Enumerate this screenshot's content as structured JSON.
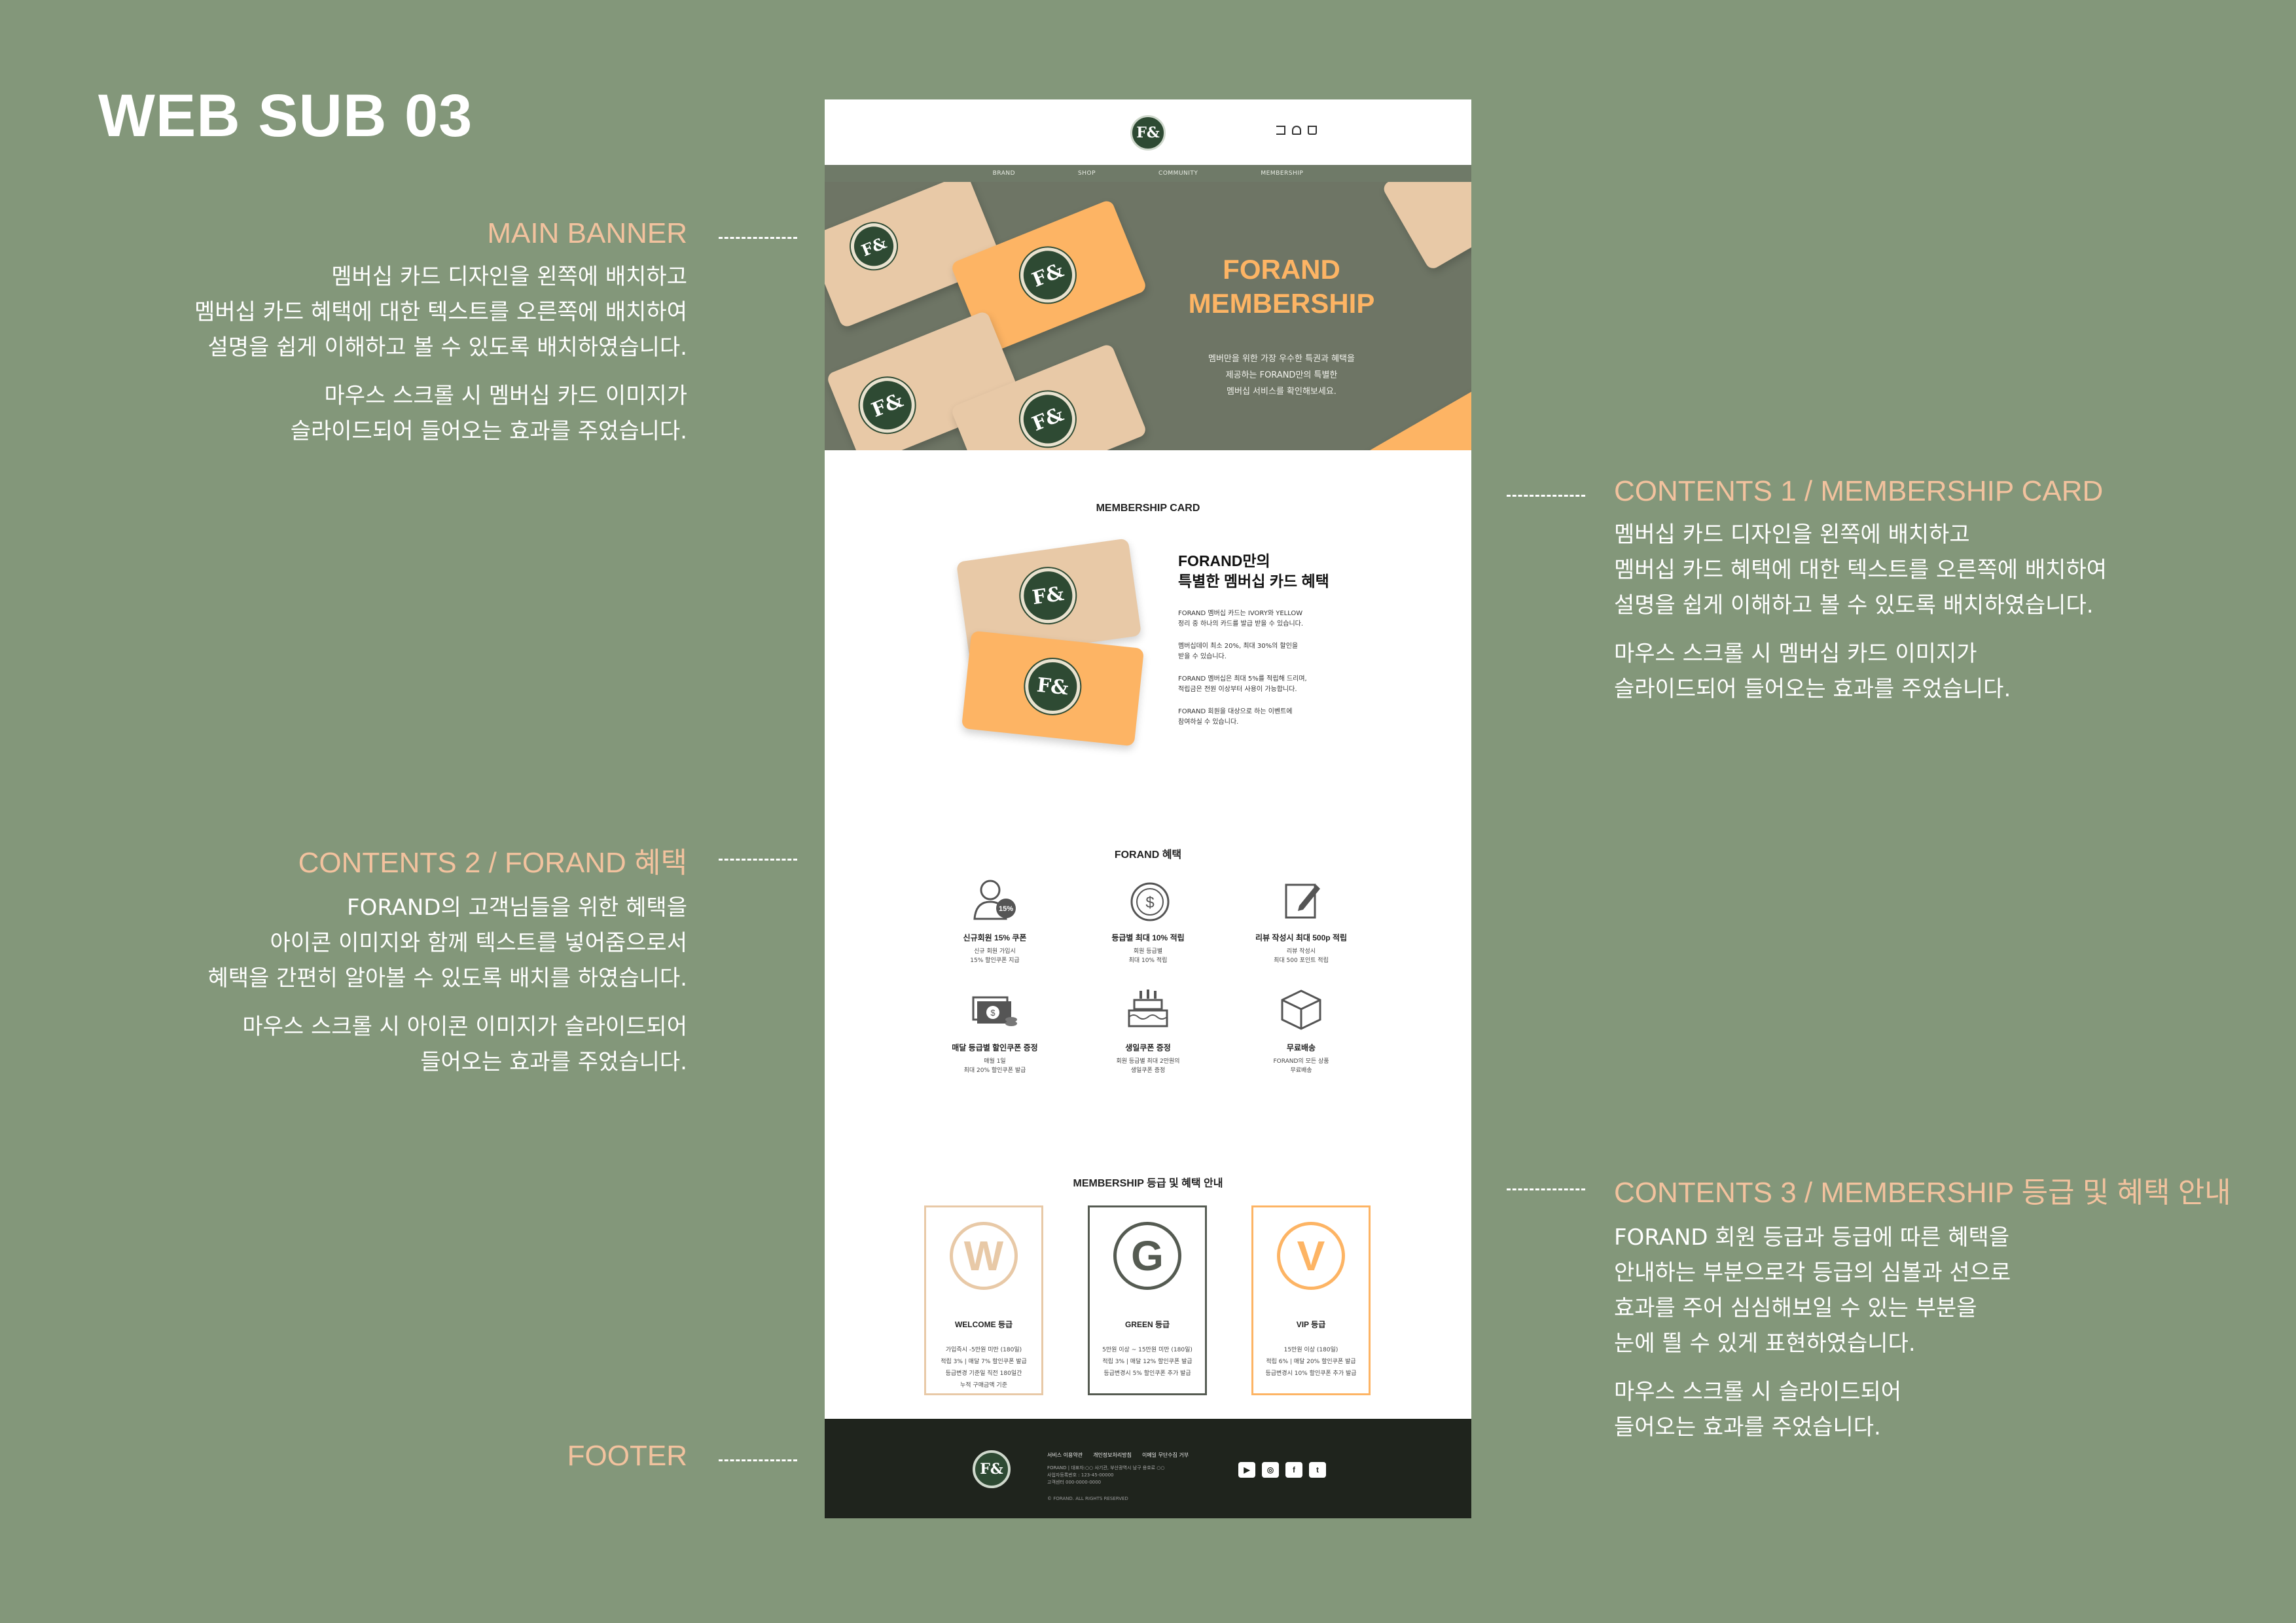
{
  "title": "WEB SUB 03",
  "notes": {
    "main_banner": {
      "title": "MAIN BANNER",
      "p1": [
        "멤버십 카드 디자인을 왼쪽에 배치하고",
        "멤버십 카드 혜택에 대한 텍스트를 오른쪽에 배치하여",
        "설명을 쉽게 이해하고 볼 수 있도록 배치하였습니다."
      ],
      "p2": [
        "마우스 스크롤 시 멤버십 카드 이미지가",
        "슬라이드되어 들어오는 효과를 주었습니다."
      ]
    },
    "contents1": {
      "title": "CONTENTS 1 / MEMBERSHIP CARD",
      "p1": [
        "멤버십 카드 디자인을 왼쪽에 배치하고",
        "멤버십 카드 혜택에 대한 텍스트를 오른쪽에 배치하여",
        "설명을 쉽게 이해하고 볼 수 있도록 배치하였습니다."
      ],
      "p2": [
        "마우스 스크롤 시 멤버십 카드 이미지가",
        "슬라이드되어 들어오는 효과를 주었습니다."
      ]
    },
    "contents2": {
      "title": "CONTENTS 2 / FORAND 혜택",
      "p1": [
        "FORAND의 고객님들을 위한 혜택을",
        "아이콘 이미지와 함께 텍스트를 넣어줌으로서",
        "혜택을 간편히 알아볼 수 있도록 배치를 하였습니다."
      ],
      "p2": [
        "마우스 스크롤 시 아이콘 이미지가 슬라이드되어",
        "들어오는 효과를 주었습니다."
      ]
    },
    "contents3": {
      "title": "CONTENTS 3 / MEMBERSHIP 등급 및 혜택 안내",
      "p1": [
        "FORAND 회원 등급과 등급에 따른 혜택을",
        "안내하는 부분으로각 등급의 심볼과 선으로",
        "효과를 주어 심심해보일 수 있는 부분을",
        "눈에 띌 수 있게 표현하였습니다."
      ],
      "p2": [
        "마우스 스크롤 시 슬라이드되어",
        "들어오는 효과를 주었습니다."
      ]
    },
    "footer": {
      "title": "FOOTER"
    }
  },
  "mock": {
    "logo": "F&",
    "nav": [
      "BRAND",
      "SHOP",
      "COMMUNITY",
      "MEMBERSHIP"
    ],
    "banner": {
      "title1": "FORAND",
      "title2": "MEMBERSHIP",
      "desc": [
        "멤버만을 위한 가장 우수한 특권과 혜택을",
        "제공하는 FORAND만의 특별한",
        "멤버십 서비스를 확인해보세요."
      ]
    },
    "membership_card": {
      "section_title": "MEMBERSHIP CARD",
      "heading1": "FORAND만의",
      "heading2": "특별한 멤버십 카드 혜택",
      "lines": [
        [
          "FORAND 멤버십 카드는 IVORY와 YELLOW",
          "정리 중 하나의 카드를 발급 받을 수 있습니다."
        ],
        [
          "멤버십데이 최소 20%, 최대 30%의 할인을",
          "받을 수 있습니다."
        ],
        [
          "FORAND 멤버십은 최대 5%를 적립해 드리며,",
          "적립금은 전원 이상부터 사용이 가능합니다."
        ],
        [
          "FORAND 회원을 대상으로 하는 이벤트에",
          "참여하실 수 있습니다."
        ]
      ]
    },
    "benefits": {
      "section_title": "FORAND 혜택",
      "items": [
        {
          "title": "신규회원 15% 쿠폰",
          "d1": "신규 회원 가입시",
          "d2": "15% 할인쿠폰 지급",
          "icon": "user-coupon-icon",
          "badge": "15%"
        },
        {
          "title": "등급별 최대 10% 적립",
          "d1": "회원 등급별",
          "d2": "최대 10% 적립",
          "icon": "coin-icon"
        },
        {
          "title": "리뷰 작성시 최대 500p 적립",
          "d1": "리뷰 작성시",
          "d2": "최대 500 포인트 적립",
          "icon": "review-edit-icon"
        },
        {
          "title": "매달 등급별 할인쿠폰 증정",
          "d1": "매월 1일",
          "d2": "최대 20% 할인쿠폰 발급",
          "icon": "money-icon"
        },
        {
          "title": "생일쿠폰 증정",
          "d1": "회원 등급별 최대 2만원의",
          "d2": "생일쿠폰 증정",
          "icon": "birthday-cake-icon"
        },
        {
          "title": "무료배송",
          "d1": "FORAND의 모든 상품",
          "d2": "무료배송",
          "icon": "box-icon"
        }
      ]
    },
    "grades": {
      "section_title": "MEMBERSHIP 등급 및 혜택 안내",
      "items": [
        {
          "letter": "W",
          "name": "WELCOME 등급",
          "lines": [
            "가입즉시 -5만원 미만 (180일)",
            "적립 3% | 매달 7% 할인쿠폰 발급",
            "등급변경 기준일 직전 180일간",
            "누적 구매금액 기준"
          ],
          "color": "#E8C9A7"
        },
        {
          "letter": "G",
          "name": "GREEN 등급",
          "lines": [
            "5만원 이상 ~ 15만원 미만 (180일)",
            "적립 3% | 매달 12% 할인쿠폰 발급",
            "등급변경시 5% 할인쿠폰 추가 발급"
          ],
          "color": "#555B52"
        },
        {
          "letter": "V",
          "name": "VIP 등급",
          "lines": [
            "15만원 이상 (180일)",
            "적립 6% | 매달 20% 할인쿠폰 발급",
            "등급변경시 10% 할인쿠폰 추가 발급"
          ],
          "color": "#FDB464"
        }
      ]
    },
    "footer": {
      "links": [
        "서비스 이용약관",
        "개인정보처리방침",
        "이메일 무단수집 거부"
      ],
      "info": [
        "FORAND | 대표자:○○ 사기관, 부산광역시 남구 용호로 ○○",
        "사업자등록번호 : 123-45-00000",
        "고객센터 000-0000-0000"
      ],
      "copyright": "© FORAND. ALL RIGHTS RESERVED",
      "social": [
        "youtube-icon",
        "instagram-icon",
        "facebook-icon",
        "twitter-icon"
      ]
    }
  }
}
